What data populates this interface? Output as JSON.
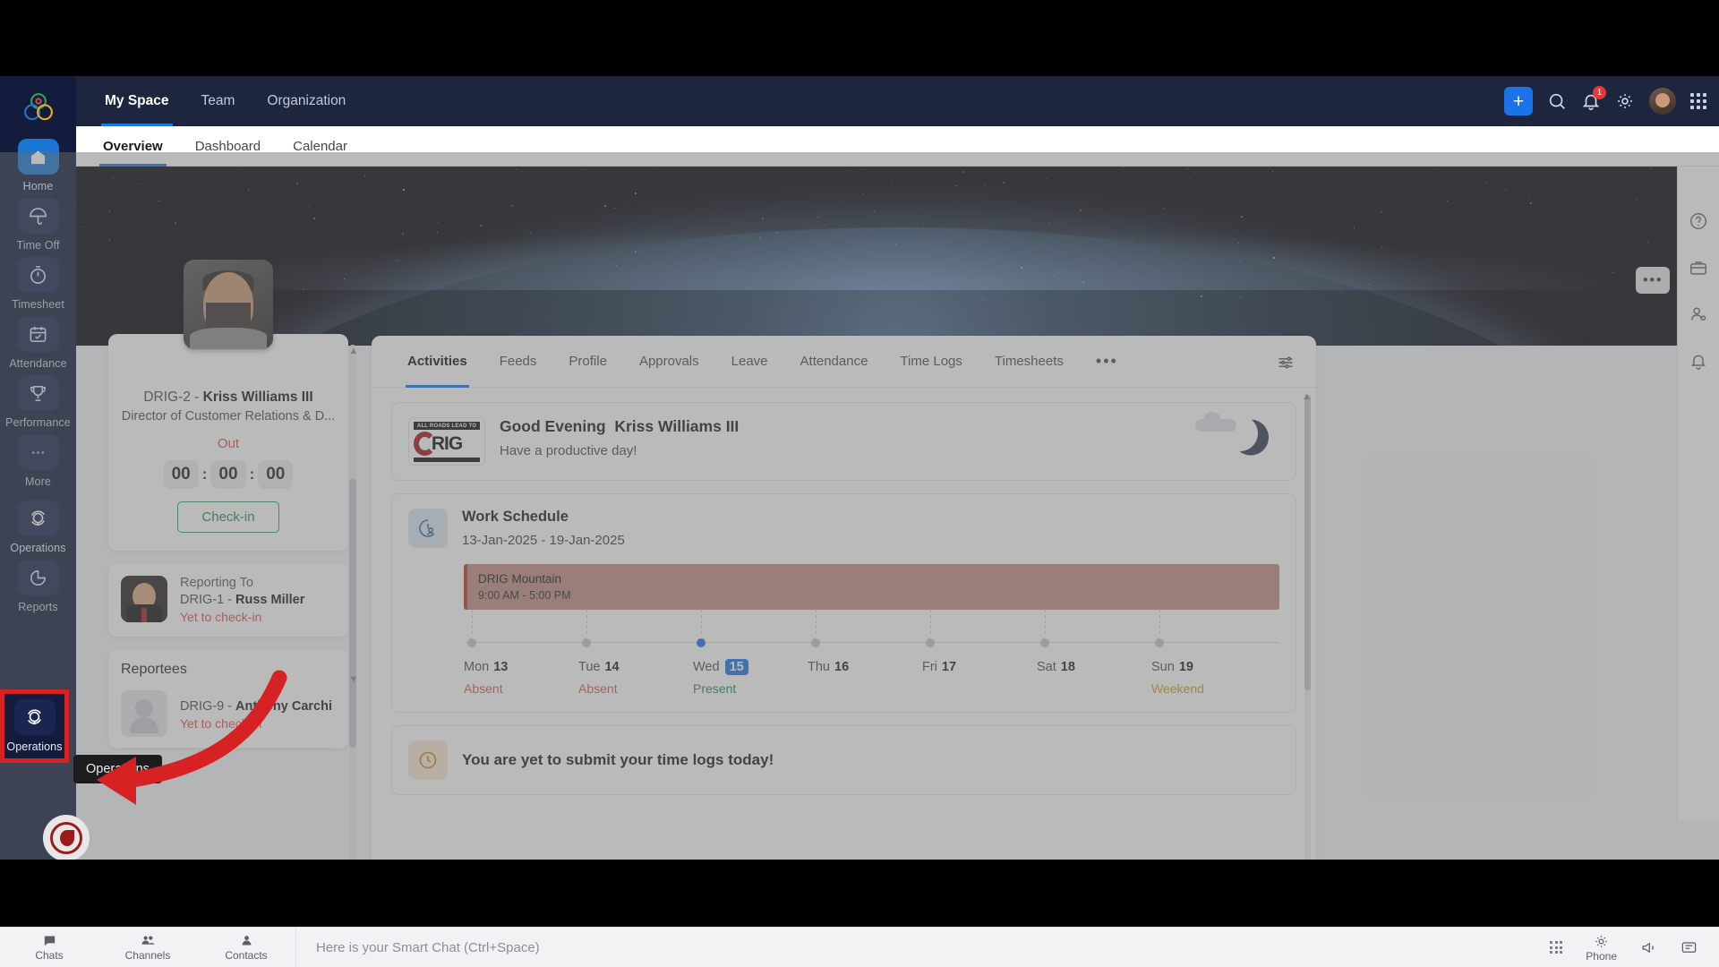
{
  "left_rail": {
    "logo_name": "app-logo",
    "items": [
      {
        "label": "Home",
        "icon": "home-icon",
        "active": true
      },
      {
        "label": "Time Off",
        "icon": "umbrella-icon",
        "active": false
      },
      {
        "label": "Timesheet",
        "icon": "stopwatch-icon",
        "active": false
      },
      {
        "label": "Attendance",
        "icon": "calendar-check-icon",
        "active": false
      },
      {
        "label": "Performance",
        "icon": "trophy-icon",
        "active": false
      },
      {
        "label": "More",
        "icon": "ellipsis-icon",
        "active": false
      },
      {
        "label": "Operations",
        "icon": "operations-icon",
        "active": true
      },
      {
        "label": "Reports",
        "icon": "pie-chart-icon",
        "active": false
      }
    ]
  },
  "topnav": {
    "items": [
      {
        "label": "My Space",
        "active": true
      },
      {
        "label": "Team",
        "active": false
      },
      {
        "label": "Organization",
        "active": false
      }
    ],
    "add_label": "+",
    "notification_count": "1",
    "icons": [
      "search-icon",
      "bell-icon",
      "gear-icon",
      "avatar",
      "apps-grid-icon"
    ]
  },
  "subtabs": {
    "items": [
      {
        "label": "Overview",
        "active": true
      },
      {
        "label": "Dashboard",
        "active": false
      },
      {
        "label": "Calendar",
        "active": false
      }
    ]
  },
  "banner": {
    "more_label": "•••"
  },
  "profile": {
    "employee_id": "DRIG-2 - ",
    "name": "Kriss Williams III",
    "role": "Director of Customer Relations & D...",
    "status": "Out",
    "timer": {
      "hours": "00",
      "minutes": "00",
      "seconds": "00",
      "separator": ":"
    },
    "checkin_label": "Check-in"
  },
  "reporting_to": {
    "title": "Reporting To",
    "employee_id": "DRIG-1 - ",
    "name": "Russ Miller",
    "status": "Yet to check-in"
  },
  "reportees": {
    "title": "Reportees",
    "list": [
      {
        "employee_id": "DRIG-9 - ",
        "name": "Anthony Carchi",
        "status": "Yet to check-in"
      }
    ]
  },
  "main_tabs": {
    "items": [
      {
        "label": "Activities",
        "active": true
      },
      {
        "label": "Feeds",
        "active": false
      },
      {
        "label": "Profile",
        "active": false
      },
      {
        "label": "Approvals",
        "active": false
      },
      {
        "label": "Leave",
        "active": false
      },
      {
        "label": "Attendance",
        "active": false
      },
      {
        "label": "Time Logs",
        "active": false
      },
      {
        "label": "Timesheets",
        "active": false
      }
    ],
    "overflow_label": "•••",
    "filter_icon": "filter-settings-icon"
  },
  "greeting": {
    "logo_tagline": "ALL ROADS LEAD TO",
    "logo_word": "RIG",
    "salutation": "Good Evening",
    "name": "Kriss Williams III",
    "subtitle": "Have a productive day!",
    "weather_icon": "moon-icon"
  },
  "work_schedule": {
    "icon": "work-schedule-icon",
    "title": "Work Schedule",
    "date_range": "13-Jan-2025  -  19-Jan-2025",
    "shift": {
      "name": "DRIG Mountain",
      "time": "9:00 AM - 5:00 PM",
      "color": "#c0392b"
    },
    "days": [
      {
        "name": "Mon",
        "num": "13",
        "status": "Absent",
        "state": "absent",
        "today": false
      },
      {
        "name": "Tue",
        "num": "14",
        "status": "Absent",
        "state": "absent",
        "today": false
      },
      {
        "name": "Wed",
        "num": "15",
        "status": "Present",
        "state": "present",
        "today": true
      },
      {
        "name": "Thu",
        "num": "16",
        "status": "",
        "state": "",
        "today": false
      },
      {
        "name": "Fri",
        "num": "17",
        "status": "",
        "state": "",
        "today": false
      },
      {
        "name": "Sat",
        "num": "18",
        "status": "",
        "state": "",
        "today": false
      },
      {
        "name": "Sun",
        "num": "19",
        "status": "Weekend",
        "state": "weekend",
        "today": false
      }
    ]
  },
  "time_logs": {
    "icon": "time-log-icon",
    "message": "You are yet to submit your time logs today!"
  },
  "right_rail": {
    "icons": [
      "help-icon",
      "briefcase-icon",
      "user-settings-icon",
      "bell-alert-icon"
    ]
  },
  "bottom_bar": {
    "items": [
      {
        "label": "Chats",
        "icon": "chat-bubble-icon"
      },
      {
        "label": "Channels",
        "icon": "people-icon"
      },
      {
        "label": "Contacts",
        "icon": "contact-icon"
      }
    ],
    "chat_placeholder": "Here is your Smart Chat (Ctrl+Space)",
    "phone_label": "Phone",
    "right_icons": [
      "apps-grid-icon",
      "phone-icon",
      "megaphone-icon",
      "chat-panel-icon"
    ]
  },
  "annotation": {
    "tooltip_text": "Operations",
    "highlight_color": "#d62222",
    "arrow_color": "#d62222",
    "brand_badge": "drig-brand-badge"
  }
}
